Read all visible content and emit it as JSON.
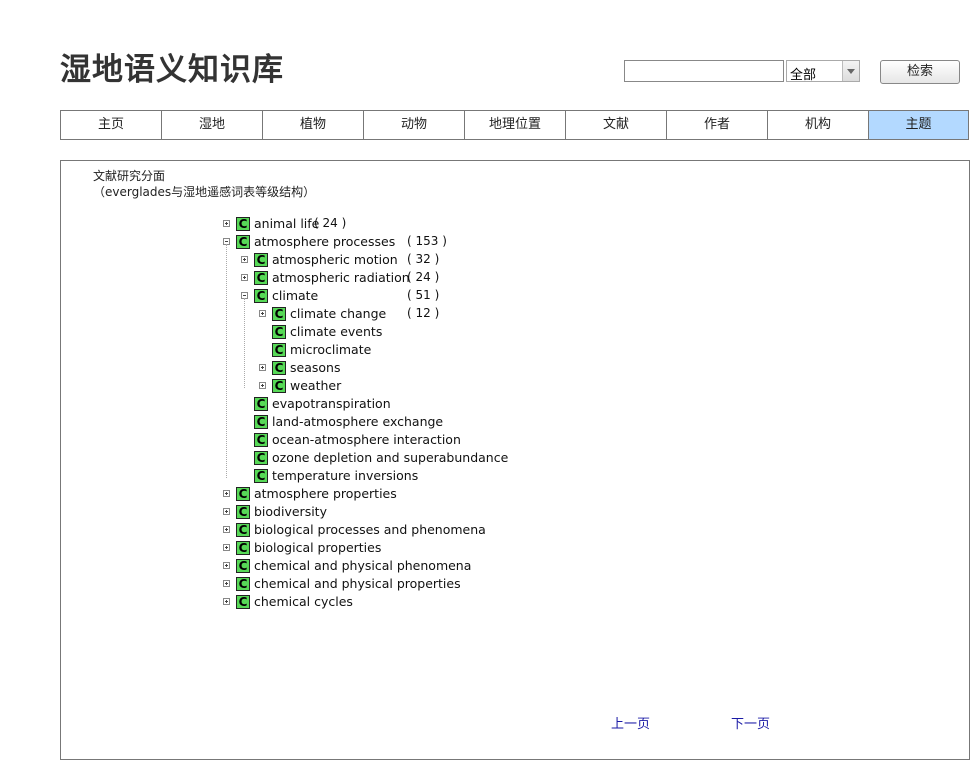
{
  "header": {
    "title": "湿地语义知识库"
  },
  "search": {
    "value": "",
    "scope": "全部",
    "button": "检索"
  },
  "nav": [
    {
      "label": "主页",
      "active": false
    },
    {
      "label": "湿地",
      "active": false
    },
    {
      "label": "植物",
      "active": false
    },
    {
      "label": "动物",
      "active": false
    },
    {
      "label": "地理位置",
      "active": false
    },
    {
      "label": "文献",
      "active": false
    },
    {
      "label": "作者",
      "active": false
    },
    {
      "label": "机构",
      "active": false
    },
    {
      "label": "主题",
      "active": true
    }
  ],
  "section": {
    "title": "文献研究分面",
    "subtitle": "（everglades与湿地遥感词表等级结构）"
  },
  "tree": [
    {
      "label": "animal life",
      "count": "( 24 )",
      "toggle": "plus",
      "depth": 0
    },
    {
      "label": "atmosphere processes",
      "count": "( 153 )",
      "toggle": "minus",
      "depth": 0
    },
    {
      "label": "atmospheric motion",
      "count": "( 32 )",
      "toggle": "plus",
      "depth": 1
    },
    {
      "label": "atmospheric radiation",
      "count": "( 24 )",
      "toggle": "plus",
      "depth": 1
    },
    {
      "label": "climate",
      "count": "( 51 )",
      "toggle": "minus",
      "depth": 1
    },
    {
      "label": "climate change",
      "count": "( 12 )",
      "toggle": "plus",
      "depth": 2
    },
    {
      "label": "climate events",
      "count": "",
      "toggle": "none",
      "depth": 2
    },
    {
      "label": "microclimate",
      "count": "",
      "toggle": "none",
      "depth": 2
    },
    {
      "label": "seasons",
      "count": "",
      "toggle": "plus",
      "depth": 2
    },
    {
      "label": "weather",
      "count": "",
      "toggle": "plus",
      "depth": 2
    },
    {
      "label": "evapotranspiration",
      "count": "",
      "toggle": "none",
      "depth": 1
    },
    {
      "label": "land-atmosphere exchange",
      "count": "",
      "toggle": "none",
      "depth": 1
    },
    {
      "label": "ocean-atmosphere interaction",
      "count": "",
      "toggle": "none",
      "depth": 1
    },
    {
      "label": "ozone depletion and superabundance",
      "count": "",
      "toggle": "none",
      "depth": 1
    },
    {
      "label": "temperature inversions",
      "count": "",
      "toggle": "none",
      "depth": 1
    },
    {
      "label": "atmosphere properties",
      "count": "",
      "toggle": "plus",
      "depth": 0
    },
    {
      "label": "biodiversity",
      "count": "",
      "toggle": "plus",
      "depth": 0
    },
    {
      "label": "biological processes and phenomena",
      "count": "",
      "toggle": "plus",
      "depth": 0
    },
    {
      "label": "biological properties",
      "count": "",
      "toggle": "plus",
      "depth": 0
    },
    {
      "label": "chemical and physical phenomena",
      "count": "",
      "toggle": "plus",
      "depth": 0
    },
    {
      "label": "chemical and physical properties",
      "count": "",
      "toggle": "plus",
      "depth": 0
    },
    {
      "label": "chemical cycles",
      "count": "",
      "toggle": "plus",
      "depth": 0
    }
  ],
  "tree_icon_letter": "C",
  "pager": {
    "prev": "上一页",
    "next": "下一页"
  }
}
